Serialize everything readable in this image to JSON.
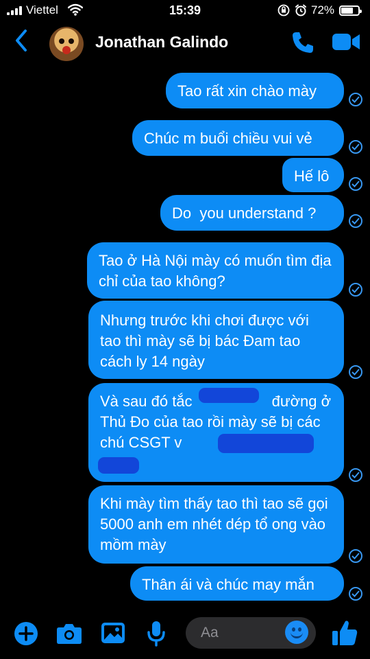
{
  "status_bar": {
    "carrier": "Viettel",
    "time": "15:39",
    "battery_percent": "72%",
    "battery_level": 0.72,
    "icons": [
      "signal-bars-icon",
      "wifi-icon",
      "orientation-lock-icon",
      "alarm-icon",
      "battery-icon"
    ]
  },
  "header": {
    "contact_name": "Jonathan Galindo",
    "icons": [
      "back-chevron-icon",
      "avatar",
      "phone-call-icon",
      "video-call-icon"
    ],
    "accent_color": "#0d8cf5"
  },
  "messages": [
    {
      "text": "Tao rất xin chào mày",
      "sender": "me",
      "status": "seen"
    },
    {
      "text": "Chúc m buổi chiều vui vẻ",
      "sender": "me",
      "status": "seen"
    },
    {
      "text": "Hế lô",
      "sender": "me",
      "status": "seen"
    },
    {
      "text": "Do  you understand ?",
      "sender": "me",
      "status": "seen"
    },
    {
      "text": "Tao ở Hà Nội mày có muốn tìm địa chỉ của tao không?",
      "sender": "me",
      "status": "seen"
    },
    {
      "text": "Nhưng trước khi chơi được với tao thì mày sẽ bị bác Đam tao cách ly 14 ngày",
      "sender": "me",
      "status": "seen"
    },
    {
      "text": "Và sau đó tắc                   đường ở Thủ Đo của tao rồi mày sẽ bị các chú CSGT v",
      "sender": "me",
      "status": "seen",
      "redacted": true
    },
    {
      "text": "Khi mày tìm thấy tao thì tao sẽ gọi 5000 anh em nhét dép tổ ong vào mồm mày",
      "sender": "me",
      "status": "seen"
    },
    {
      "text": "Thân ái và chúc may mắn",
      "sender": "me",
      "status": "seen"
    }
  ],
  "composer": {
    "placeholder": "Aa",
    "icons": [
      "plus-icon",
      "camera-icon",
      "image-icon",
      "microphone-icon",
      "emoji-icon",
      "thumbs-up-icon"
    ]
  }
}
